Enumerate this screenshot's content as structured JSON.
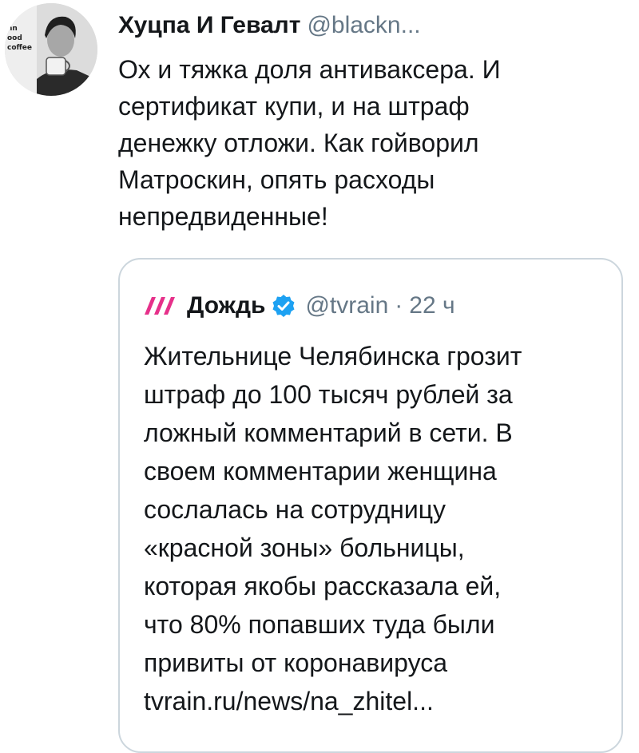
{
  "tweet": {
    "author_name": "Хуцпа И Гевалт",
    "author_handle": "@blackn...",
    "avatar_text": [
      "nn",
      "ood",
      "coffee"
    ],
    "text_lines": [
      "Ох и тяжка доля антиваксера. И",
      "сертификат купи, и на штраф",
      "денежку отложи. Как гойворил",
      "Матроскин, опять расходы",
      "непредвиденные!"
    ]
  },
  "quoted_tweet": {
    "author_name": "Дождь",
    "author_handle": "@tvrain",
    "separator": "·",
    "time": "22 ч",
    "verified": true,
    "logo_icon": "tvrain-logo-icon",
    "text_lines": [
      "Жительнице Челябинска грозит",
      "штраф до 100 тысяч рублей за",
      "ложный комментарий в сети. В",
      "своем комментарии женщина",
      "сослалась на сотрудницу",
      "«красной зоны» больницы,",
      "которая якобы рассказала ей,",
      "что 80% попавших туда были",
      "привиты от коронавируса",
      "tvrain.ru/news/na_zhitel..."
    ]
  },
  "colors": {
    "text": "#14171a",
    "secondary_text": "#657786",
    "border": "#ccd6dd",
    "verified_blue": "#1da1f2",
    "tvrain_logo": "#e6308a"
  }
}
